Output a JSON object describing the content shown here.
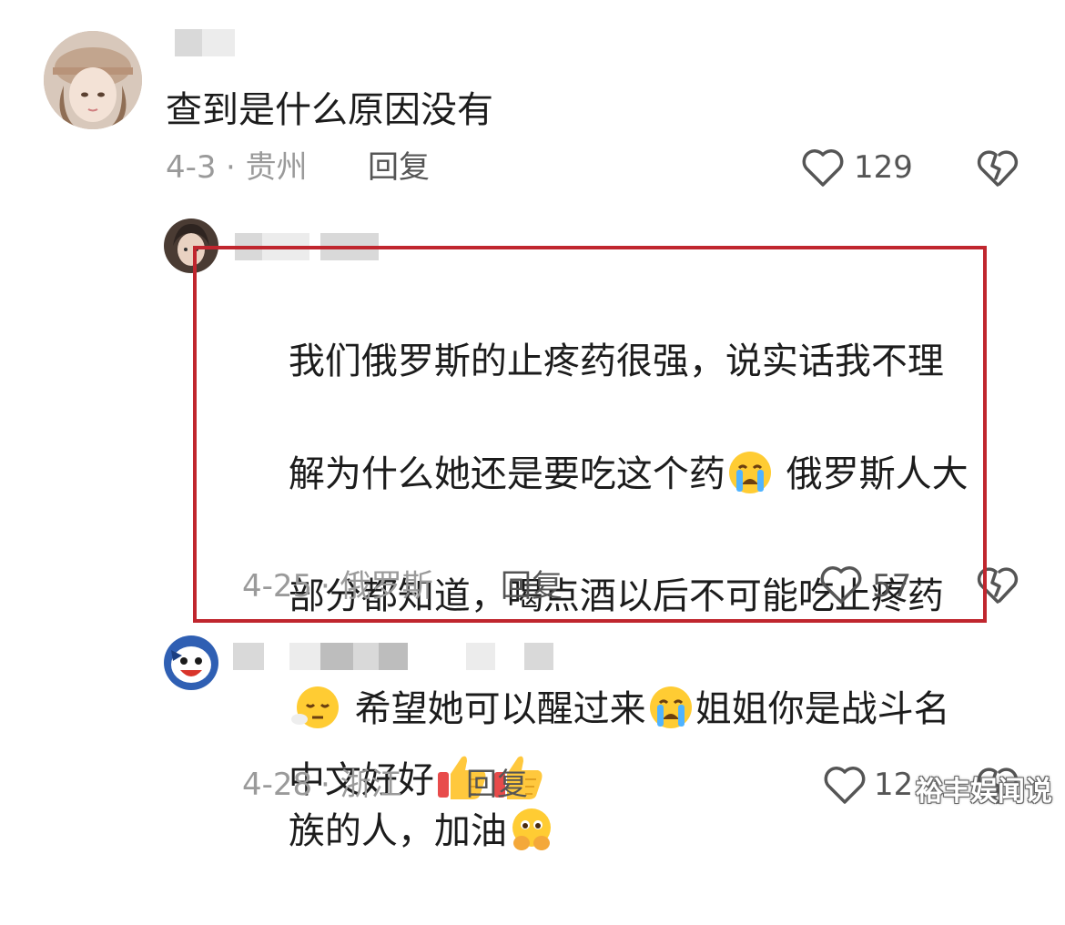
{
  "comments": [
    {
      "text": "查到是什么原因没有",
      "date": "4-3",
      "location": "· 贵州",
      "reply_label": "回复",
      "likes": "129"
    },
    {
      "text_parts": [
        "我们俄罗斯的止疼药很强，说实话我不理",
        "解为什么她还是要吃这个药",
        " 俄罗斯人大",
        "部分都知道，喝点酒以后不可能吃止疼药",
        " 希望她可以醒过来",
        "姐姐你是战斗名",
        "族的人，加油"
      ],
      "date": "4-25",
      "location": "· 俄罗斯",
      "reply_label": "回复",
      "likes": "57"
    },
    {
      "text": "中文好好",
      "date": "4-28",
      "location": "· 浙江",
      "reply_label": "回复",
      "likes": "12"
    }
  ],
  "watermark": "裕丰娱闻说",
  "colors": {
    "highlight_border": "#c0262e",
    "meta_text": "#9a9a9a",
    "body_text": "#1c1c1c"
  },
  "icons": [
    "heart-outline-icon",
    "broken-heart-icon",
    "crying-face-emoji",
    "relieved-face-emoji",
    "face-holding-back-tears-emoji",
    "thumbs-up-emoji"
  ]
}
